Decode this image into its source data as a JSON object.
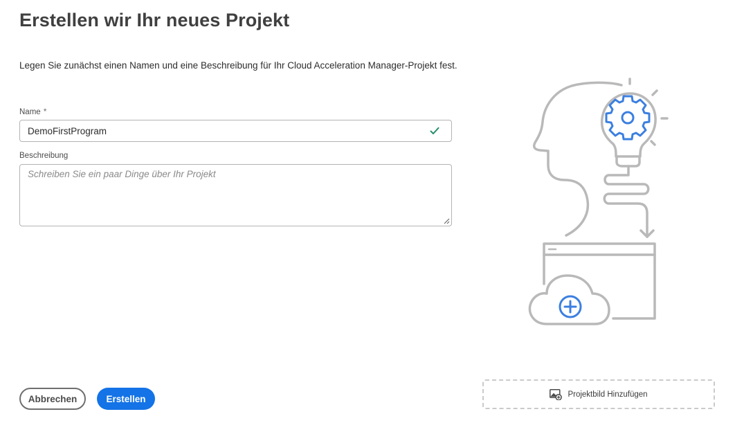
{
  "page": {
    "title": "Erstellen wir Ihr neues Projekt",
    "intro": "Legen Sie zunächst einen Namen und eine Beschreibung für Ihr Cloud Acceleration Manager-Projekt fest."
  },
  "form": {
    "name_label": "Name",
    "name_required_marker": "*",
    "name_value": "DemoFirstProgram",
    "name_valid_icon": "checkmark-icon",
    "description_label": "Beschreibung",
    "description_placeholder": "Schreiben Sie ein paar Dinge über Ihr Projekt",
    "description_value": ""
  },
  "actions": {
    "cancel_label": "Abbrechen",
    "create_label": "Erstellen"
  },
  "image_upload": {
    "label": "Projektbild Hinzufügen",
    "icon": "add-image-icon"
  },
  "colors": {
    "accent": "#1473e6",
    "valid": "#268e6c",
    "illustration_stroke": "#b9b9b9",
    "illustration_accent": "#3b7fe0"
  }
}
